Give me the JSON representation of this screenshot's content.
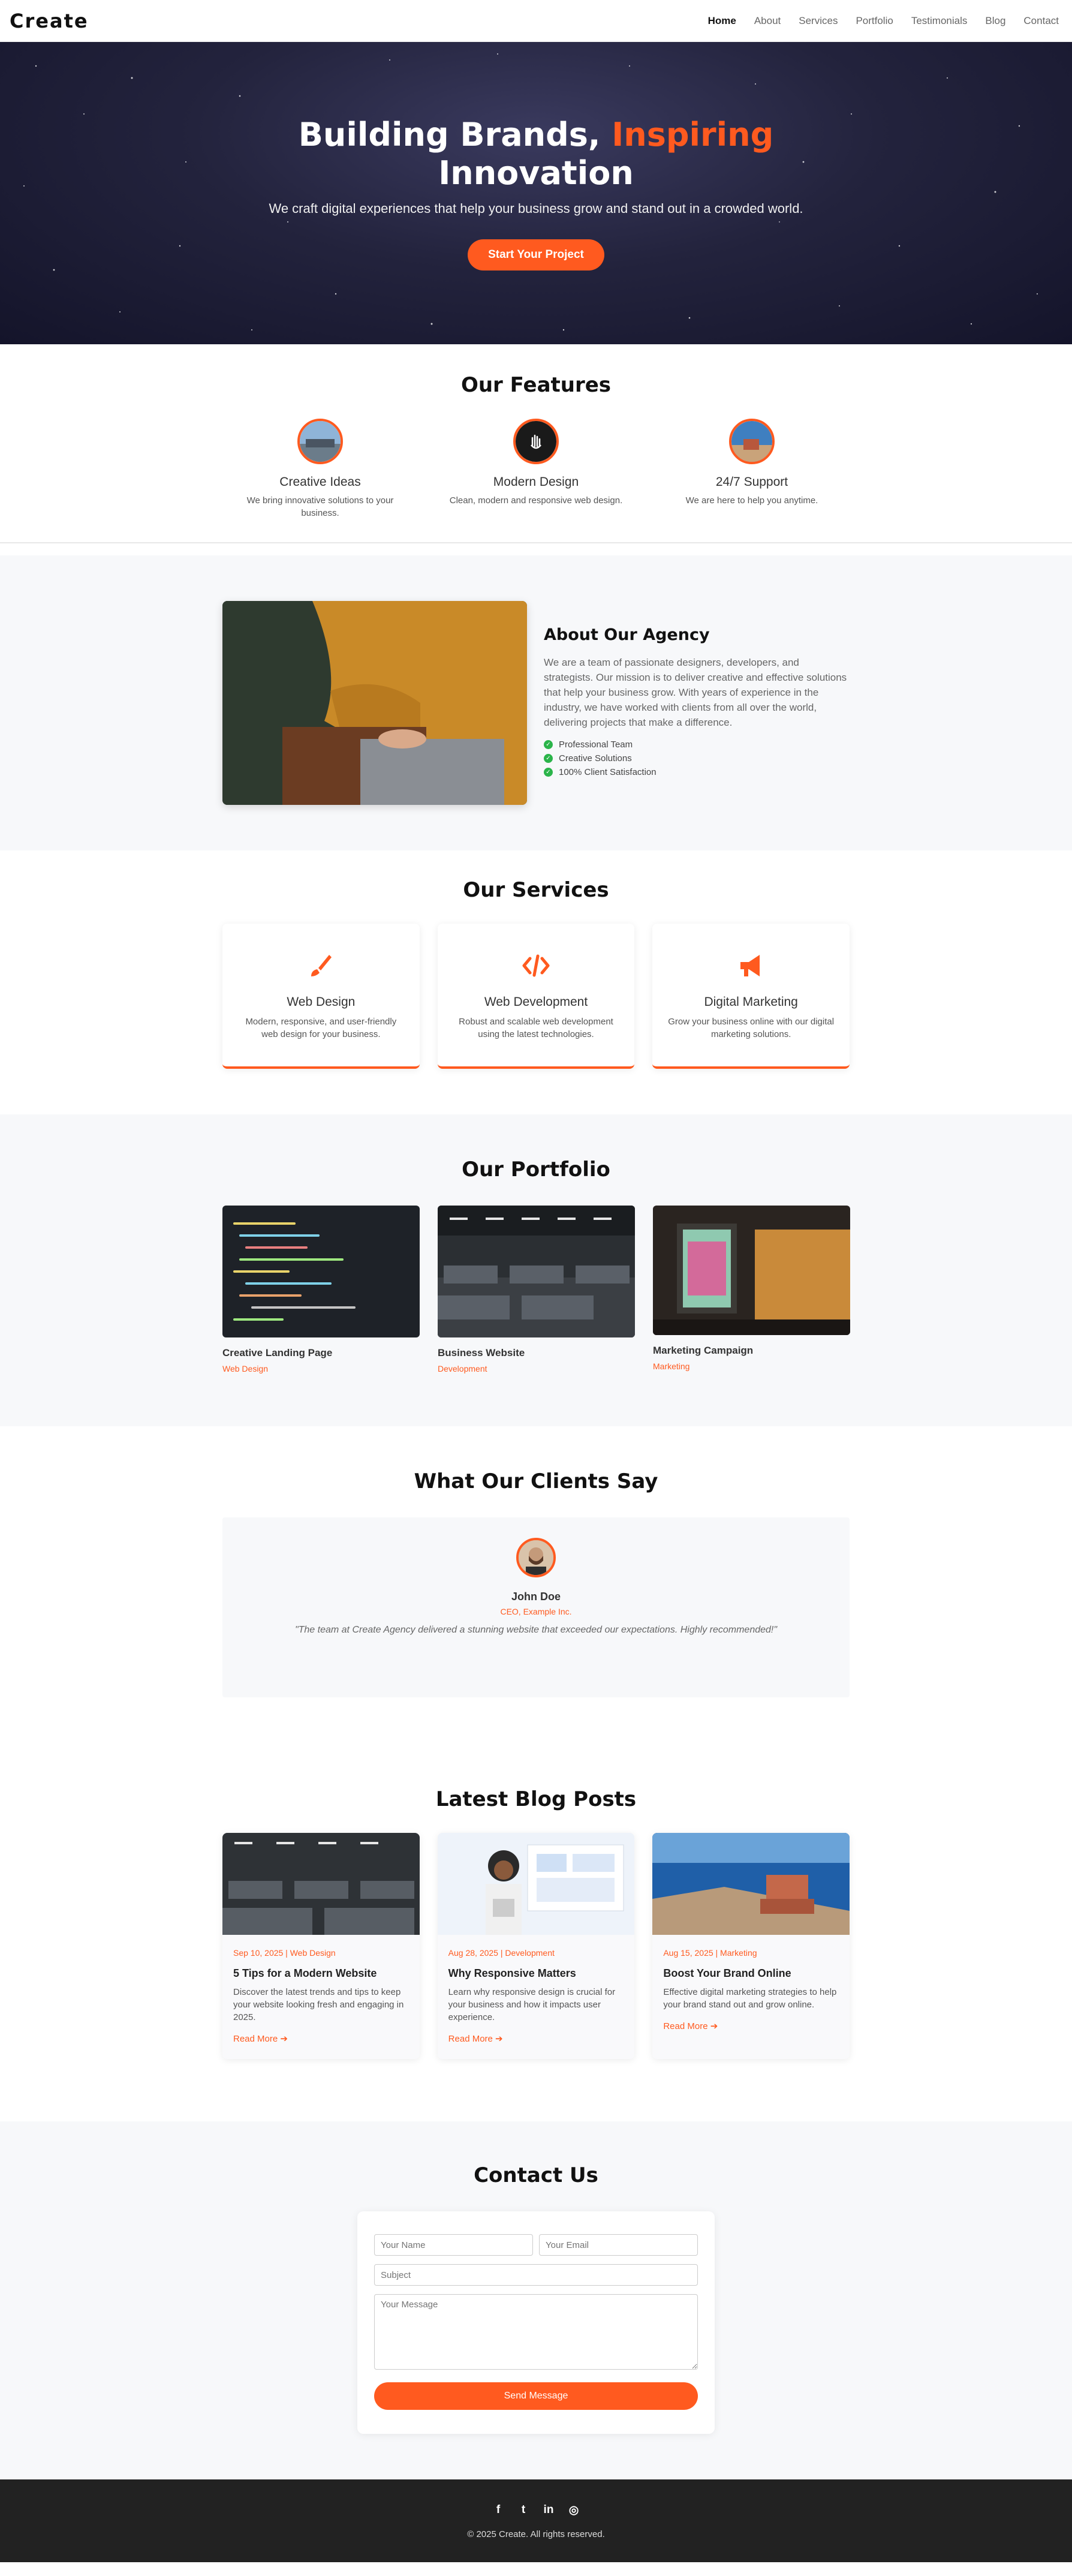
{
  "nav": {
    "logo": "Create",
    "links": [
      "Home",
      "About",
      "Services",
      "Portfolio",
      "Testimonials",
      "Blog",
      "Contact"
    ]
  },
  "hero": {
    "title_part1": "Building Brands, ",
    "title_accent": "Inspiring",
    "title_part2": "Innovation",
    "subtitle": "We craft digital experiences that help your business grow and stand out in a crowded world.",
    "cta": "Start Your Project"
  },
  "features": {
    "title": "Our Features",
    "items": [
      {
        "title": "Creative Ideas",
        "text": "We bring innovative solutions to your business.",
        "icon": "landscape-photo-icon"
      },
      {
        "title": "Modern Design",
        "text": "Clean, modern and responsive web design.",
        "icon": "hand-icon"
      },
      {
        "title": "24/7 Support",
        "text": "We are here to help you anytime.",
        "icon": "sofa-photo-icon"
      }
    ]
  },
  "about": {
    "title": "About Our Agency",
    "text": "We are a team of passionate designers, developers, and strategists. Our mission is to deliver creative and effective solutions that help your business grow. With years of experience in the industry, we have worked with clients from all over the world, delivering projects that make a difference.",
    "checks": [
      "Professional Team",
      "Creative Solutions",
      "100% Client Satisfaction"
    ]
  },
  "services": {
    "title": "Our Services",
    "items": [
      {
        "title": "Web Design",
        "text": "Modern, responsive, and user-friendly web design for your business.",
        "icon": "paintbrush-icon"
      },
      {
        "title": "Web Development",
        "text": "Robust and scalable web development using the latest technologies.",
        "icon": "code-icon"
      },
      {
        "title": "Digital Marketing",
        "text": "Grow your business online with our digital marketing solutions.",
        "icon": "megaphone-icon"
      }
    ]
  },
  "portfolio": {
    "title": "Our Portfolio",
    "items": [
      {
        "title": "Creative Landing Page",
        "category": "Web Design"
      },
      {
        "title": "Business Website",
        "category": "Development"
      },
      {
        "title": "Marketing Campaign",
        "category": "Marketing"
      }
    ]
  },
  "testimonial": {
    "title": "What Our Clients Say",
    "name": "John Doe",
    "role": "CEO, Example Inc.",
    "quote": "\"The team at Create Agency delivered a stunning website that exceeded our expectations. Highly recommended!\""
  },
  "blog": {
    "title": "Latest Blog Posts",
    "posts": [
      {
        "meta": "Sep 10, 2025 | Web Design",
        "title": "5 Tips for a Modern Website",
        "text": "Discover the latest trends and tips to keep your website looking fresh and engaging in 2025.",
        "more": "Read More"
      },
      {
        "meta": "Aug 28, 2025 | Development",
        "title": "Why Responsive Matters",
        "text": "Learn why responsive design is crucial for your business and how it impacts user experience.",
        "more": "Read More"
      },
      {
        "meta": "Aug 15, 2025 | Marketing",
        "title": "Boost Your Brand Online",
        "text": "Effective digital marketing strategies to help your brand stand out and grow online.",
        "more": "Read More"
      }
    ]
  },
  "contact": {
    "title": "Contact Us",
    "name_placeholder": "Your Name",
    "email_placeholder": "Your Email",
    "subject_placeholder": "Subject",
    "message_placeholder": "Your Message",
    "send": "Send Message"
  },
  "footer": {
    "social": [
      "facebook-icon",
      "twitter-icon",
      "linkedin-icon",
      "instagram-icon"
    ],
    "copyright": "© 2025 Create. All rights reserved."
  },
  "colors": {
    "accent": "#ff5a1f",
    "dark": "#222222",
    "check": "#2bb44a"
  }
}
